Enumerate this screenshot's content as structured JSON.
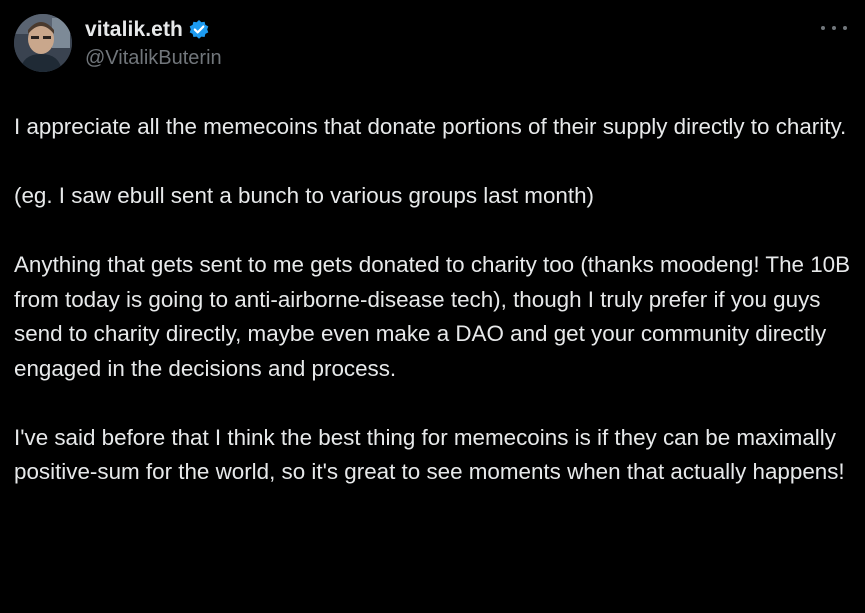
{
  "author": {
    "display_name": "vitalik.eth",
    "handle": "@VitalikButerin",
    "verified": true,
    "avatar_icon": "profile-photo-avatar"
  },
  "menu": {
    "icon": "more-horizontal-icon"
  },
  "colors": {
    "background": "#000000",
    "text_primary": "#e7e9ea",
    "text_secondary": "#71767b",
    "verified_badge": "#1d9bf0"
  },
  "tweet": {
    "paragraphs": [
      "I appreciate all the memecoins that donate portions of their supply directly to charity.",
      "(eg. I saw ebull sent a bunch to various groups last month)",
      "Anything that gets sent to me gets donated to charity too (thanks moodeng! The 10B from today is going to anti-airborne-disease tech), though I truly prefer if you guys send to charity directly, maybe even make a DAO and get your community directly engaged in the decisions and process.",
      "I've said before that I think the best thing for memecoins is if they can be maximally positive-sum for the world, so it's great to see moments when that actually happens!"
    ]
  }
}
